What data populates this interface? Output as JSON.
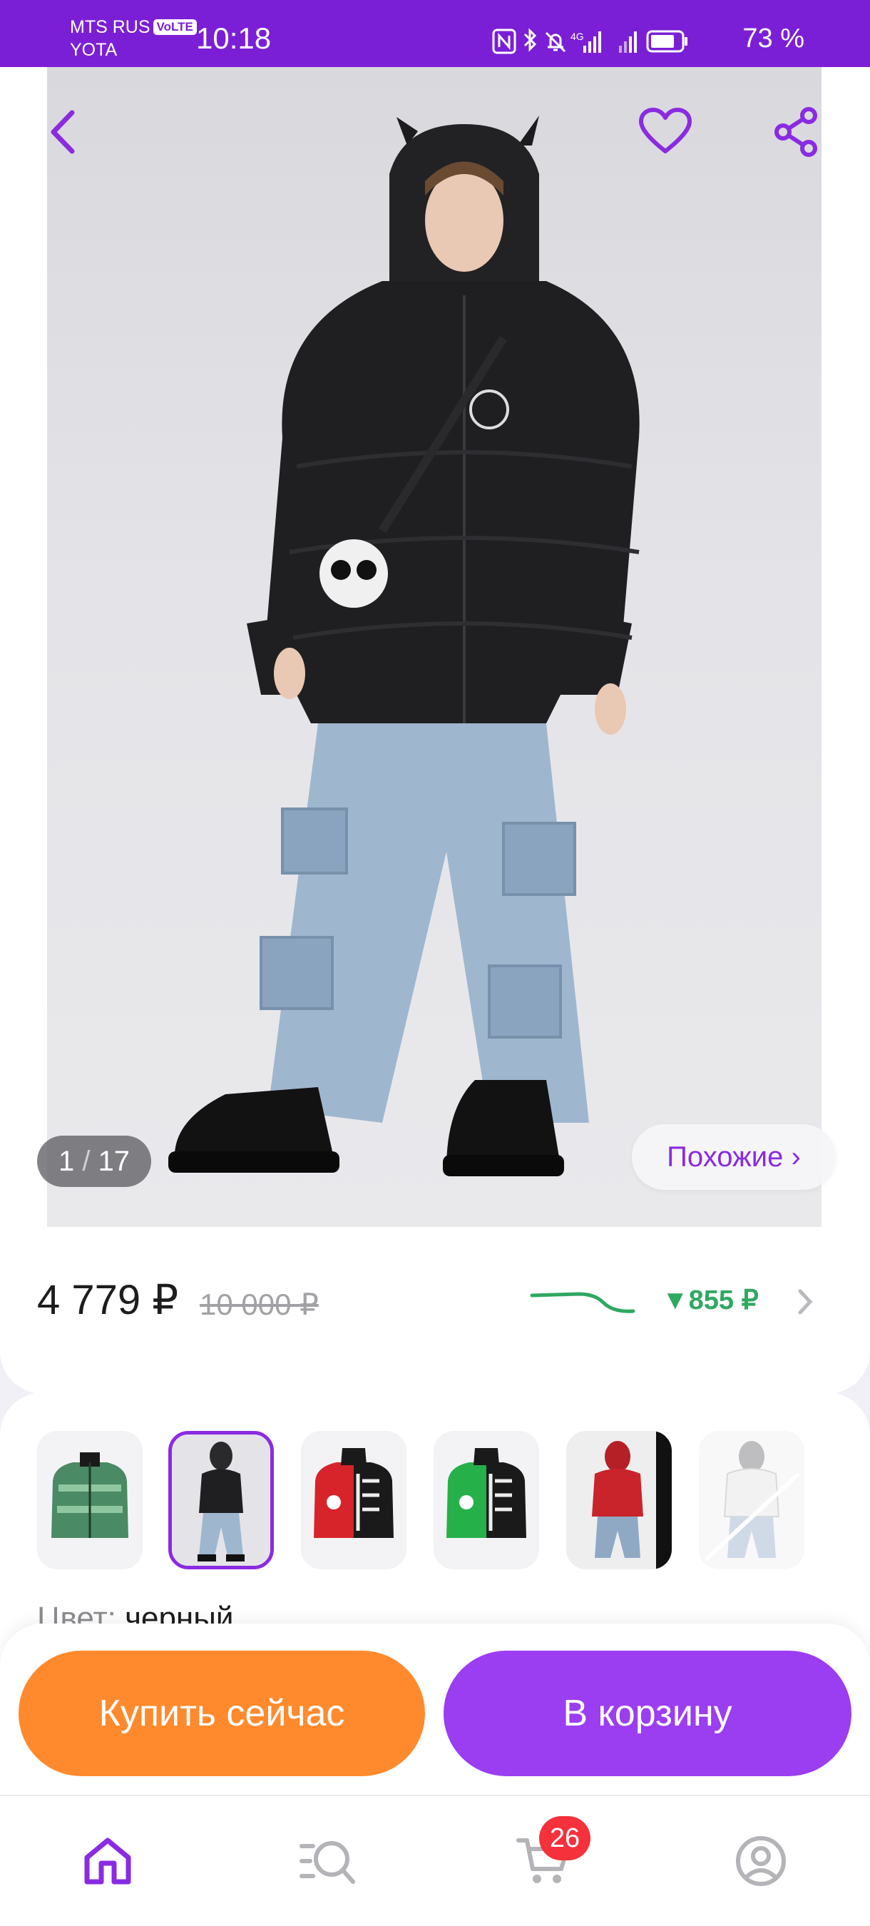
{
  "status_bar": {
    "carrier_1": "MTS RUS",
    "volte": "VoLTE",
    "carrier_2": "YOTA",
    "time": "10:18",
    "network": "4G",
    "battery": "73 %"
  },
  "gallery": {
    "current": "1",
    "separator": "/",
    "total": "17",
    "similar_label": "Похожие ›",
    "icons": [
      "back-arrow-icon",
      "heart-icon",
      "share-icon"
    ]
  },
  "price": {
    "current": "4 779 ₽",
    "old": "10 000 ₽",
    "drop": "▼855 ₽"
  },
  "variants": {
    "thumbs": [
      "green-jacket",
      "black-jacket-model",
      "red-black-jacket",
      "green-black-jacket",
      "red-jacket-model",
      "white-jacket-model"
    ],
    "selected_index": 1,
    "color_key": "Цвет:",
    "color_value": "черный"
  },
  "actions": {
    "buy_now": "Купить сейчас",
    "add_to_cart": "В корзину"
  },
  "nav": {
    "items": [
      "home-icon",
      "catalog-search-icon",
      "cart-icon",
      "profile-icon"
    ],
    "cart_count": "26"
  },
  "colors": {
    "brand": "#7b1fd6",
    "accent": "#8a2be2",
    "buy": "#ff8a2d",
    "cart": "#9b3df0",
    "price_drop": "#2fa862",
    "badge": "#f5313b"
  }
}
